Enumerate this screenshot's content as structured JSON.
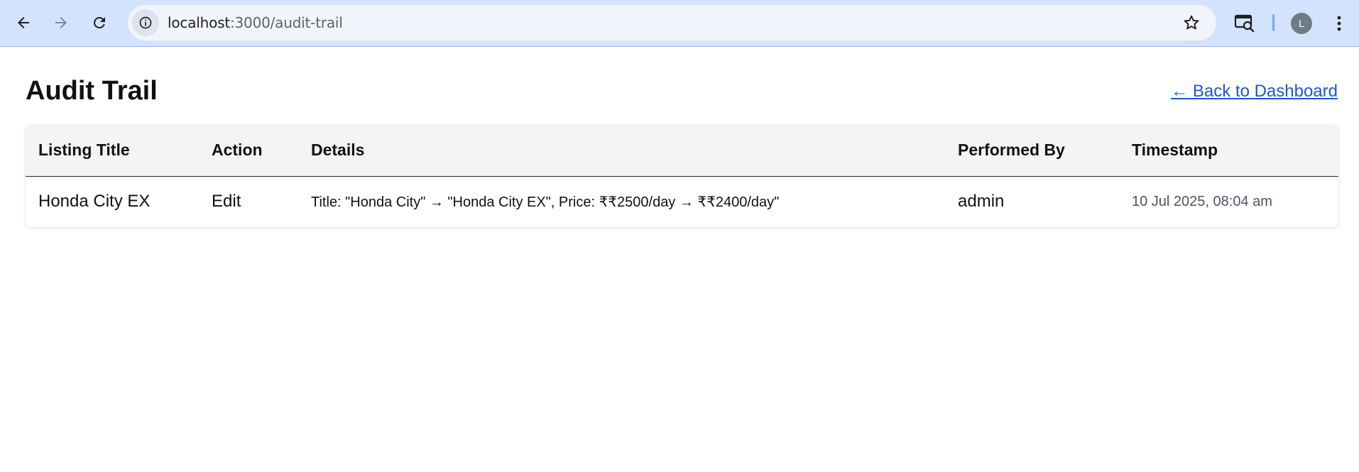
{
  "browser": {
    "url_host": "localhost",
    "url_path": ":3000/audit-trail",
    "profile_initial": "L",
    "icons": {
      "back": "arrow-left-icon",
      "forward": "arrow-right-icon",
      "reload": "reload-icon",
      "site_info": "info-icon",
      "bookmark": "star-icon",
      "extension": "search-screen-icon",
      "menu": "kebab-menu-icon"
    }
  },
  "page": {
    "title": "Audit Trail",
    "back_link": "← Back to Dashboard"
  },
  "table": {
    "headers": {
      "listing_title": "Listing Title",
      "action": "Action",
      "details": "Details",
      "performed_by": "Performed By",
      "timestamp": "Timestamp"
    },
    "rows": [
      {
        "listing_title": "Honda City EX",
        "action": "Edit",
        "details": "Title: \"Honda City\" → \"Honda City EX\", Price: ₹₹2500/day → ₹₹2400/day\"",
        "performed_by": "admin",
        "timestamp": "10 Jul 2025, 08:04 am"
      }
    ]
  },
  "colors": {
    "chrome_bg": "#d3e3fd",
    "link": "#1a56db",
    "header_bg": "#f3f4f6"
  }
}
